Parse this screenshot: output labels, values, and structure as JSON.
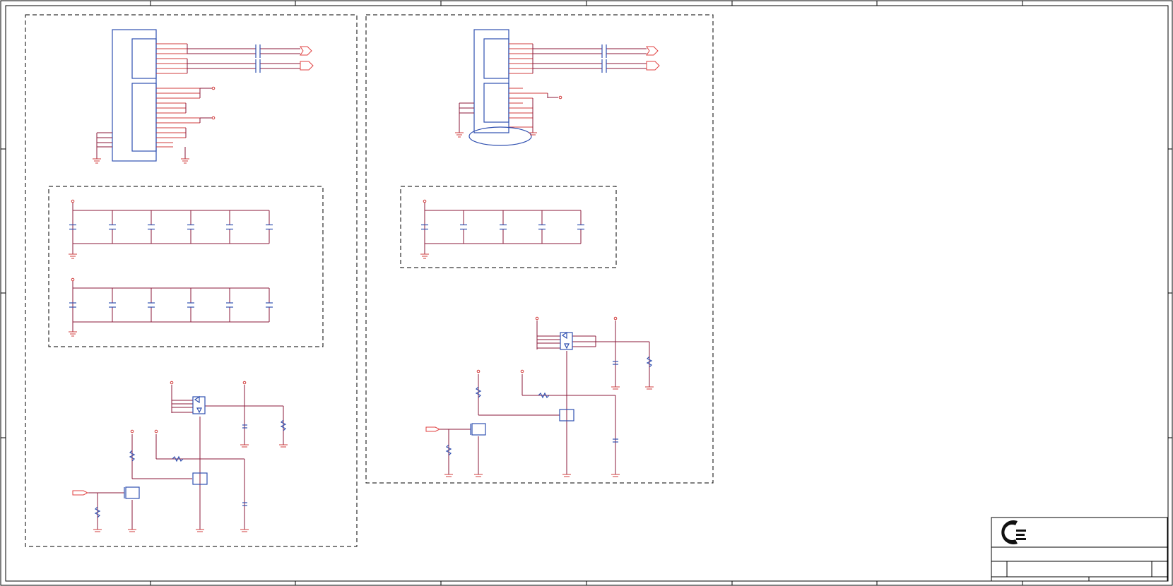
{
  "sheet": {
    "title": "",
    "colors": {
      "frame": "#000000",
      "wire": "#8b1a3a",
      "pin": "#d23c3c",
      "component": "#3050b0",
      "port": "#e04040"
    }
  },
  "blocks": [
    {
      "id": "left-connector-block"
    },
    {
      "id": "right-connector-block"
    }
  ],
  "title_block": {
    "logo": "company-logo"
  }
}
